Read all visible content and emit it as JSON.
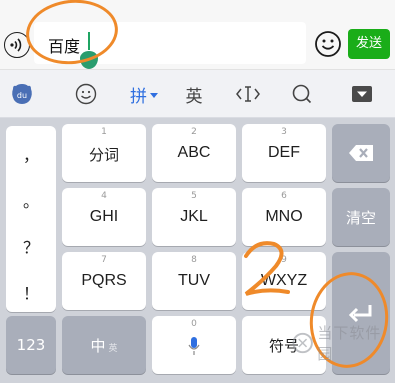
{
  "chat": {
    "input_value": "百度",
    "send_label": "发送"
  },
  "toolbar": {
    "pinyin_label": "拼",
    "english_label": "英"
  },
  "keyboard": {
    "punctuation": [
      "，",
      "。",
      "？",
      "！"
    ],
    "keys": [
      {
        "num": "1",
        "label": "分词"
      },
      {
        "num": "2",
        "label": "ABC"
      },
      {
        "num": "3",
        "label": "DEF"
      },
      {
        "num": "4",
        "label": "GHI"
      },
      {
        "num": "5",
        "label": "JKL"
      },
      {
        "num": "6",
        "label": "MNO"
      },
      {
        "num": "7",
        "label": "PQRS"
      },
      {
        "num": "8",
        "label": "TUV"
      },
      {
        "num": "9",
        "label": "WXYZ"
      }
    ],
    "clear_label": "清空",
    "num_mode_label": "123",
    "cn_label": "中",
    "en_small_label": "英",
    "space_num": "0",
    "symbol_label": "符号"
  },
  "annotation": {
    "step_number": "2"
  },
  "watermark": {
    "text": "当下软件园"
  },
  "colors": {
    "send_green": "#1aad19",
    "pinyin_blue": "#2f6fe0",
    "annotation_orange": "#ef8a2a",
    "function_key_gray": "#a9aeba"
  },
  "icons": [
    "voice-icon",
    "emoji-icon",
    "skin-icon",
    "smiley-icon",
    "cursor-icon",
    "search-icon",
    "hide-keyboard-icon",
    "backspace-icon",
    "enter-icon",
    "microphone-icon"
  ]
}
